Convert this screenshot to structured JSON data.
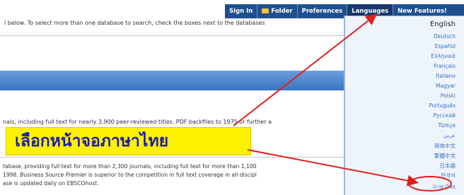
{
  "nav": {
    "items": [
      "Sign In",
      "Folder",
      "Preferences",
      "Languages",
      "New Features!"
    ],
    "active": "Languages"
  },
  "instructions": "l below. To select more than one database to search, check the boxes next to the databases",
  "db1_desc": "nals, including full text for nearly 3,900 peer-reviewed titles. PDF backfiles to 1975 or further a",
  "db2_desc": {
    "line1": "tabase, providing full text for more than 2,300 journals, including full text for more than 1,100",
    "line2a": "1998. ",
    "line2b": "Business Source Premier",
    "line2c": " is superior to the competition in full text coverage in all discipl",
    "line3a": "ase is updated daily on EBSCO",
    "line3b": "host",
    "line3c": "."
  },
  "callout_text": "เลือกหน้าจอภาษาไทย",
  "languages": [
    "English",
    "Deutsch",
    "Español",
    "Ελληνικά",
    "Français",
    "Italiano",
    "Magyar",
    "Polski",
    "Português",
    "Русский",
    "Türkçe",
    "عربي",
    "简体中文",
    "繁體中文",
    "日本語",
    "한국어",
    "ภาษาไทย"
  ],
  "colors": {
    "nav_bg": "#1f4f8f",
    "callout_bg": "#fff200",
    "callout_text": "#1d1daa",
    "annotation": "#e0201e",
    "link": "#3a6fbf"
  }
}
